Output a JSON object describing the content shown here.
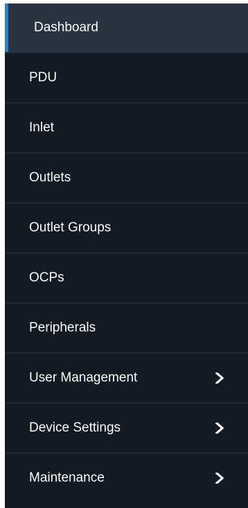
{
  "colors": {
    "sidebar_bg": "#131a23",
    "active_bg": "#2a3441",
    "active_indicator": "#2f80c8",
    "divider": "#1f2833",
    "text": "#ffffff"
  },
  "nav": {
    "items": [
      {
        "label": "Dashboard",
        "active": true,
        "has_submenu": false
      },
      {
        "label": "PDU",
        "active": false,
        "has_submenu": false
      },
      {
        "label": "Inlet",
        "active": false,
        "has_submenu": false
      },
      {
        "label": "Outlets",
        "active": false,
        "has_submenu": false
      },
      {
        "label": "Outlet Groups",
        "active": false,
        "has_submenu": false
      },
      {
        "label": "OCPs",
        "active": false,
        "has_submenu": false
      },
      {
        "label": "Peripherals",
        "active": false,
        "has_submenu": false
      },
      {
        "label": "User Management",
        "active": false,
        "has_submenu": true,
        "icon": "chevron-right-icon"
      },
      {
        "label": "Device Settings",
        "active": false,
        "has_submenu": true,
        "icon": "chevron-right-icon"
      },
      {
        "label": "Maintenance",
        "active": false,
        "has_submenu": true,
        "icon": "chevron-right-icon"
      }
    ]
  }
}
